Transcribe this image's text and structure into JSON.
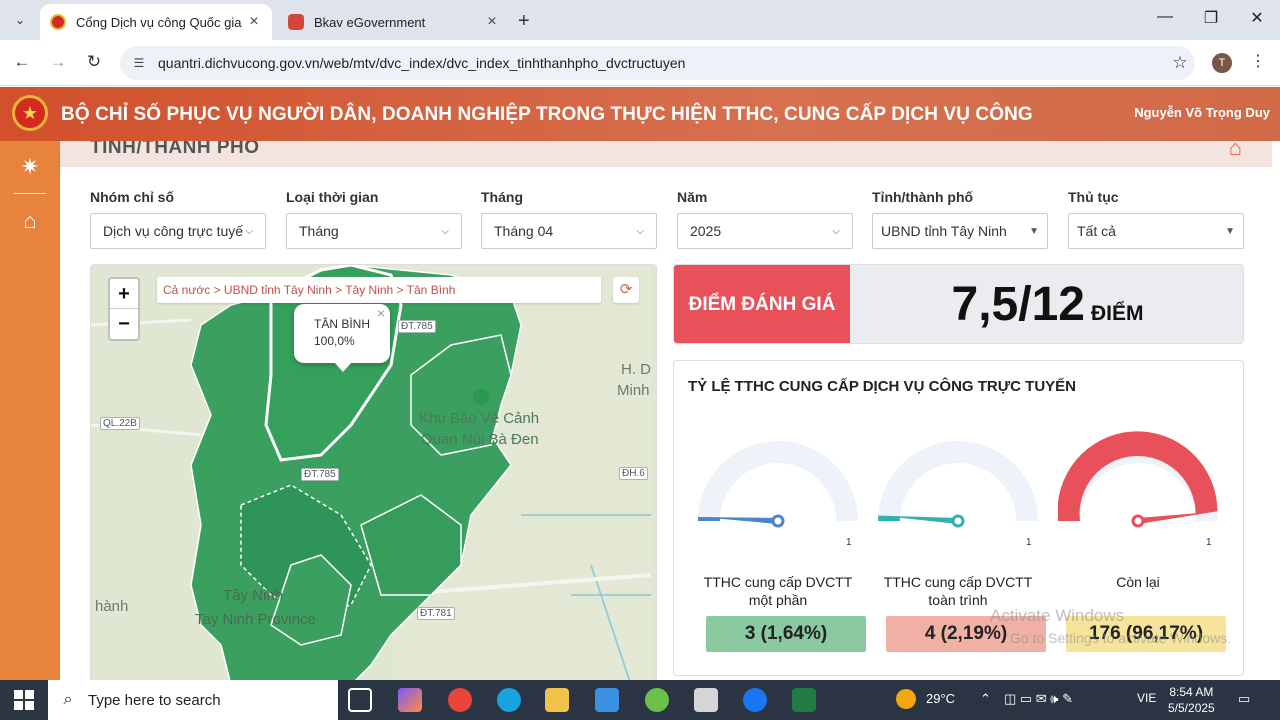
{
  "browser": {
    "tabs": [
      {
        "title": "Cổng Dịch vụ công Quốc gia",
        "active": true
      },
      {
        "title": "Bkav eGovernment",
        "active": false
      }
    ],
    "url": "quantri.dichvucong.gov.vn/web/mtv/dvc_index/dvc_index_tinhthanhpho_dvctructuyen",
    "profile_initial": "T"
  },
  "header": {
    "headline": "BỘ CHỈ SỐ PHỤC VỤ NGƯỜI DÂN, DOANH NGHIỆP TRONG THỰC HIỆN TTHC, CUNG CẤP DỊCH VỤ CÔNG",
    "user": "Nguyễn Võ Trọng Duy"
  },
  "section": {
    "title": "TỈNH/THÀNH PHỐ"
  },
  "filters": [
    {
      "label": "Nhóm chỉ số",
      "value": "Dịch vụ công trực tuyế"
    },
    {
      "label": "Loại thời gian",
      "value": "Tháng"
    },
    {
      "label": "Tháng",
      "value": "Tháng 04"
    },
    {
      "label": "Năm",
      "value": "2025"
    },
    {
      "label": "Tỉnh/thành phố",
      "value": "UBND tỉnh Tây Ninh"
    },
    {
      "label": "Thủ tục",
      "value": "Tất cả"
    }
  ],
  "map": {
    "zoom_in": "+",
    "zoom_out": "−",
    "breadcrumb": "Cả nước > UBND tỉnh Tây Ninh > Tây Ninh > Tân Bình",
    "popup_name": "TÂN BÌNH",
    "popup_value": "100,0%",
    "labels": {
      "h_d": "H. D",
      "minh": "Minh",
      "khu_bao_ve_1": "Khu Bảo Vệ Cảnh",
      "khu_bao_ve_2": "Quan Núi Bà Đen",
      "tay_ninh": "Tây Ninh",
      "tay_ninh_province": "Tay Ninh Province",
      "thanh": "hành"
    },
    "roads": {
      "ql22b": "QL.22B",
      "dt785_a": "ĐT.785",
      "dt785_b": "ĐT.785",
      "dh6": "ĐH.6",
      "dt781": "ĐT.781"
    },
    "colors": {
      "region": "#2f9e5a",
      "highlight": "#3aa866"
    }
  },
  "score": {
    "label": "ĐIỂM ĐÁNH GIÁ",
    "value": "7,5/12",
    "unit": "ĐIỂM"
  },
  "ratio": {
    "title": "TỶ LỆ TTHC CUNG CẤP DỊCH VỤ CÔNG TRỰC TUYẾN",
    "gauges": [
      {
        "caption_1": "TTHC cung cấp DVCTT",
        "caption_2": "một phần",
        "value": "3 (1,64%)",
        "fraction": 0.0164,
        "max_label": "1",
        "color": "#4a86c8",
        "box": "#8bc9a1"
      },
      {
        "caption_1": "TTHC cung cấp DVCTT",
        "caption_2": "toàn trình",
        "value": "4 (2,19%)",
        "fraction": 0.0219,
        "max_label": "1",
        "color": "#35b0b2",
        "box": "#f0b0a6"
      },
      {
        "caption_1": "Còn lại",
        "caption_2": "",
        "value": "176 (96,17%)",
        "fraction": 0.9617,
        "max_label": "1",
        "color": "#e8505a",
        "box": "#f6e49a"
      }
    ]
  },
  "watermark": {
    "line1": "Activate Windows",
    "line2": "Go to Settings to activate Windows."
  },
  "taskbar": {
    "search_placeholder": "Type here to search",
    "weather": "29°C",
    "lang": "VIE",
    "time": "8:54 AM",
    "date": "5/5/2025"
  }
}
